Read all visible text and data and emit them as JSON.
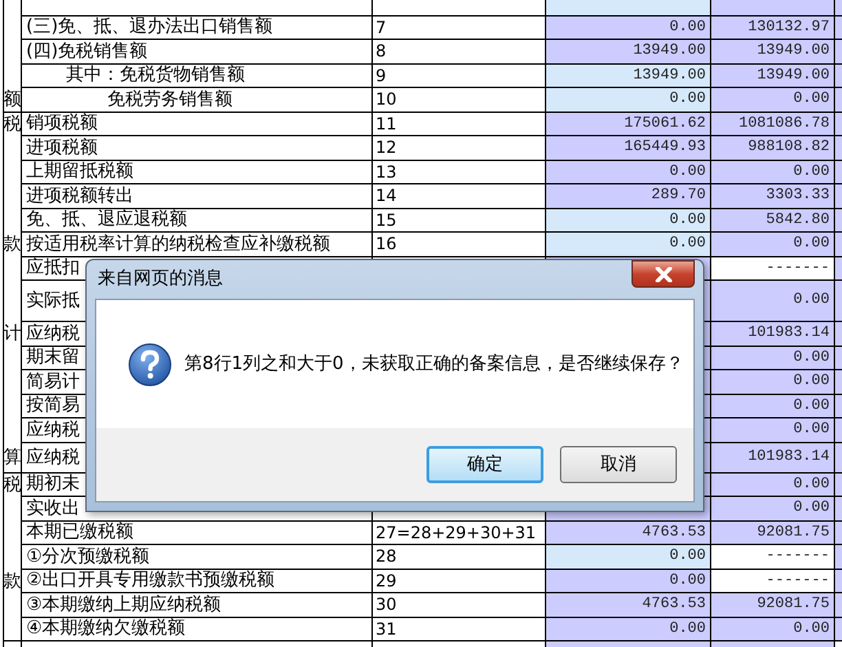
{
  "form": {
    "sections": [
      {
        "rows": [
          {
            "kind": "lead",
            "current": {
              "color": "#d5e9fb"
            },
            "cumulative": {
              "color": "#ccccff"
            }
          },
          {
            "kind": "main",
            "item": "(三)免、抵、退办法出口销售额",
            "number": "7",
            "current": {
              "text": "0.00",
              "color": "#ccccff"
            },
            "cumulative": {
              "text": "130132.97",
              "color": "#ccccff"
            }
          },
          {
            "kind": "main",
            "item": "(四)免税销售额",
            "number": "8",
            "current": {
              "text": "13949.00",
              "color": "#ccccff"
            },
            "cumulative": {
              "text": "13949.00",
              "color": "#ccccff"
            }
          },
          {
            "kind": "lead",
            "item": "其中：免税货物销售额",
            "number": "9",
            "current": {
              "text": "13949.00",
              "color": "#d5e9fb"
            },
            "cumulative": {
              "text": "13949.00",
              "color": "#ccccff"
            }
          },
          {
            "kind": "follow",
            "side": "额",
            "item": "免税劳务销售额",
            "number": "10",
            "current": {
              "text": "0.00",
              "color": "#d5e9fb"
            },
            "cumulative": {
              "text": "0.00",
              "color": "#ccccff"
            }
          }
        ]
      },
      {
        "rows": [
          {
            "kind": "main",
            "side": "税",
            "item": "销项税额",
            "number": "11",
            "current": {
              "text": "175061.62",
              "color": "#ccccff"
            },
            "cumulative": {
              "text": "1081086.78",
              "color": "#ccccff"
            }
          },
          {
            "kind": "main",
            "item": "进项税额",
            "number": "12",
            "current": {
              "text": "165449.93",
              "color": "#ccccff"
            },
            "cumulative": {
              "text": "988108.82",
              "color": "#ccccff"
            }
          },
          {
            "kind": "main",
            "item": "上期留抵税额",
            "number": "13",
            "current": {
              "text": "0.00",
              "color": "#ccccff"
            },
            "cumulative": {
              "text": "0.00",
              "color": "#ccccff"
            }
          },
          {
            "kind": "main",
            "item": "进项税额转出",
            "number": "14",
            "current": {
              "text": "289.70",
              "color": "#ccccff"
            },
            "cumulative": {
              "text": "3303.33",
              "color": "#ccccff"
            }
          },
          {
            "kind": "main",
            "item": "免、抵、退应退税额",
            "number": "15",
            "current": {
              "text": "0.00",
              "color": "#d5e9fb"
            },
            "cumulative": {
              "text": "5842.80",
              "color": "#ccccff"
            }
          },
          {
            "kind": "main",
            "side": "款",
            "item": "按适用税率计算的纳税检查应补缴税额",
            "number": "16",
            "current": {
              "text": "0.00",
              "color": "#d5e9fb"
            },
            "cumulative": {
              "text": "0.00",
              "color": "#ccccff"
            }
          },
          {
            "kind": "main",
            "item": "应抵扣",
            "cumulative": {
              "text": "-------",
              "color": "#ffffff"
            }
          },
          {
            "kind": "tall",
            "item": "实际抵",
            "cumulative": {
              "text": "0.00",
              "color": "#ccccff"
            }
          },
          {
            "kind": "main",
            "side": "计",
            "item": "应纳税",
            "cumulative": {
              "text": "101983.14",
              "color": "#ccccff"
            }
          },
          {
            "kind": "main",
            "item": "期末留",
            "cumulative": {
              "text": "0.00",
              "color": "#ccccff"
            }
          },
          {
            "kind": "main",
            "item": "简易计",
            "cumulative": {
              "text": "0.00",
              "color": "#ccccff"
            }
          },
          {
            "kind": "main",
            "item": "按简易",
            "cumulative": {
              "text": "0.00",
              "color": "#ccccff"
            }
          },
          {
            "kind": "main",
            "item": "应纳税",
            "cumulative": {
              "text": "0.00",
              "color": "#ccccff"
            }
          },
          {
            "kind": "mid",
            "side": "算",
            "item": "应纳税",
            "cumulative": {
              "text": "101983.14",
              "color": "#ccccff"
            }
          }
        ]
      },
      {
        "rows": [
          {
            "kind": "main",
            "side": "税",
            "item": "期初未",
            "cumulative": {
              "text": "0.00",
              "color": "#ccccff"
            }
          },
          {
            "kind": "main",
            "item": "实收出",
            "cumulative": {
              "text": "0.00",
              "color": "#ccccff"
            }
          },
          {
            "kind": "main",
            "item": "本期已缴税额",
            "number": "27=28+29+30+31",
            "current": {
              "text": "4763.53",
              "color": "#ccccff"
            },
            "cumulative": {
              "text": "92081.75",
              "color": "#ccccff"
            }
          },
          {
            "kind": "main",
            "item": "①分次预缴税额",
            "number": "28",
            "current": {
              "text": "0.00",
              "color": "#d5e9fb"
            },
            "cumulative": {
              "text": "-------",
              "color": "#ffffff"
            }
          },
          {
            "kind": "main",
            "side": "款",
            "item": "②出口开具专用缴款书预缴税额",
            "number": "29",
            "current": {
              "text": "0.00",
              "color": "#ccccff"
            },
            "cumulative": {
              "text": "-------",
              "color": "#ffffff"
            }
          },
          {
            "kind": "main",
            "item": "③本期缴纳上期应纳税额",
            "number": "30",
            "current": {
              "text": "4763.53",
              "color": "#ccccff"
            },
            "cumulative": {
              "text": "92081.75",
              "color": "#ccccff"
            }
          },
          {
            "kind": "main",
            "item": "④本期缴纳欠缴税额",
            "number": "31",
            "current": {
              "text": "0.00",
              "color": "#ccccff"
            },
            "cumulative": {
              "text": "0.00",
              "color": "#ccccff"
            }
          }
        ]
      }
    ]
  },
  "dialog": {
    "title": "来自网页的消息",
    "message": "第8行1列之和大于0，未获取正确的备案信息，是否继续保存？",
    "buttons": [
      {
        "label": "确定",
        "selected": true
      },
      {
        "label": "取消",
        "selected": false
      }
    ]
  }
}
